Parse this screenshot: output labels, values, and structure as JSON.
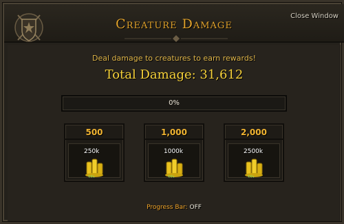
{
  "window": {
    "title": "Creature Damage",
    "close_label": "Close Window"
  },
  "intro": "Deal damage to creatures to earn rewards!",
  "total_damage": "Total Damage: 31,612",
  "progress": {
    "text": "0%",
    "fraction": 0
  },
  "tiers": [
    {
      "threshold": "500",
      "reward_amount": "250k",
      "reward_icon": "coins-icon"
    },
    {
      "threshold": "1,000",
      "reward_amount": "1000k",
      "reward_icon": "coins-icon"
    },
    {
      "threshold": "2,000",
      "reward_amount": "2500k",
      "reward_icon": "coins-icon"
    }
  ],
  "footer": {
    "label": "Progress Bar:",
    "value": "OFF"
  },
  "colors": {
    "title": "#e2a32b",
    "total": "#f7d23a",
    "tier_label": "#f1b431",
    "coin": "#e9c21e"
  }
}
